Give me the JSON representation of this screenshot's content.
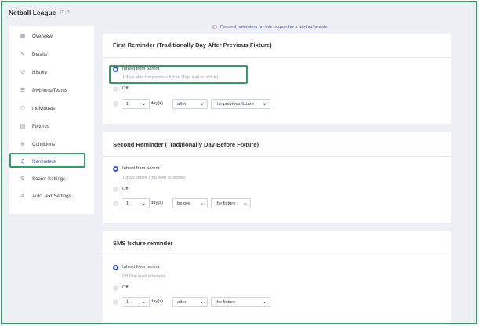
{
  "header": {
    "title": "Netball League",
    "id_label": "ID: 3"
  },
  "sidebar": {
    "items": [
      {
        "label": "Overview",
        "icon": "grid-icon"
      },
      {
        "label": "Details",
        "icon": "pencil-icon"
      },
      {
        "label": "History",
        "icon": "history-icon"
      },
      {
        "label": "Divisions/Teams",
        "icon": "list-icon"
      },
      {
        "label": "Individuals",
        "icon": "users-icon"
      },
      {
        "label": "Fixtures",
        "icon": "calendar-icon"
      },
      {
        "label": "Conditions",
        "icon": "settings-icon"
      },
      {
        "label": "Reminders",
        "icon": "bell-icon",
        "active": true
      },
      {
        "label": "Scorer Settings",
        "icon": "cogs-icon"
      },
      {
        "label": "Auto Text Settings",
        "icon": "text-icon"
      }
    ]
  },
  "resend_link": "Resend reminders for this league for a particular date",
  "cards": [
    {
      "title": "First Reminder (Traditionally Day After Previous Fixture)",
      "inherit_label": "Inherit from parent",
      "inherit_sub": "1 days after the previous fixture (Top level schedule)",
      "off_label": "Off",
      "count_value": "1",
      "unit_label": "day(s)",
      "relation_value": "after",
      "anchor_value": "the previous fixture"
    },
    {
      "title": "Second Reminder (Traditionally Day Before Fixture)",
      "inherit_label": "Inherit from parent",
      "inherit_sub": "1 days before (Top level schedule)",
      "off_label": "Off",
      "count_value": "1",
      "unit_label": "day(s)",
      "relation_value": "before",
      "anchor_value": "the fixture"
    },
    {
      "title": "SMS fixture reminder",
      "inherit_label": "Inherit from parent",
      "inherit_sub": "Off (Top level schedule)",
      "off_label": "Off",
      "count_value": "1",
      "unit_label": "day(s)",
      "relation_value": "after",
      "anchor_value": "the fixture"
    }
  ],
  "colors": {
    "accent": "#3a56d4",
    "highlight": "#2f9e62",
    "background": "#eef0f5"
  }
}
